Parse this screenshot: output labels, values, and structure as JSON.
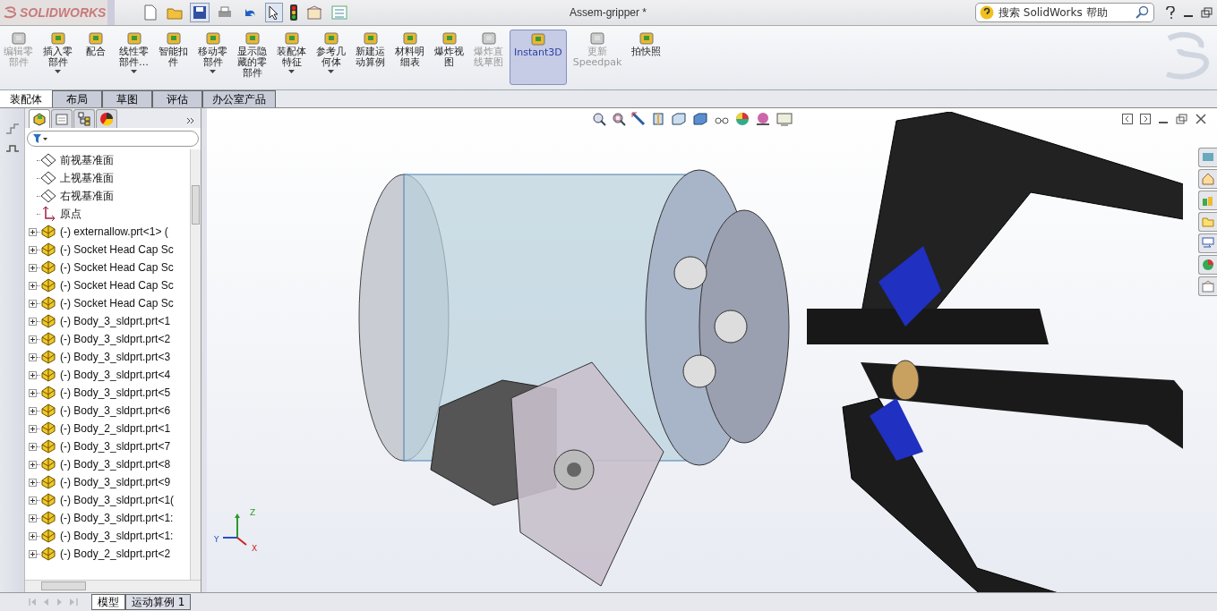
{
  "app": {
    "brand": "SOLIDWORKS"
  },
  "window": {
    "title": "Assem-gripper *"
  },
  "search": {
    "placeholder": "搜索 SolidWorks 帮助"
  },
  "ribbon": [
    {
      "lines": [
        "编辑零",
        "部件"
      ],
      "disabled": true,
      "dropdown": false,
      "selected": false
    },
    {
      "lines": [
        "插入零",
        "部件"
      ],
      "disabled": false,
      "dropdown": true,
      "selected": false
    },
    {
      "lines": [
        "配合"
      ],
      "disabled": false,
      "dropdown": false,
      "selected": false
    },
    {
      "lines": [
        "线性零",
        "部件…"
      ],
      "disabled": false,
      "dropdown": true,
      "selected": false
    },
    {
      "lines": [
        "智能扣",
        "件"
      ],
      "disabled": false,
      "dropdown": false,
      "selected": false
    },
    {
      "lines": [
        "移动零",
        "部件"
      ],
      "disabled": false,
      "dropdown": true,
      "selected": false
    },
    {
      "lines": [
        "显示隐",
        "藏的零",
        "部件"
      ],
      "disabled": false,
      "dropdown": false,
      "selected": false
    },
    {
      "lines": [
        "装配体",
        "特征"
      ],
      "disabled": false,
      "dropdown": true,
      "selected": false
    },
    {
      "lines": [
        "参考几",
        "何体"
      ],
      "disabled": false,
      "dropdown": true,
      "selected": false
    },
    {
      "lines": [
        "新建运",
        "动算例"
      ],
      "disabled": false,
      "dropdown": false,
      "selected": false
    },
    {
      "lines": [
        "材料明",
        "细表"
      ],
      "disabled": false,
      "dropdown": false,
      "selected": false
    },
    {
      "lines": [
        "爆炸视",
        "图"
      ],
      "disabled": false,
      "dropdown": false,
      "selected": false
    },
    {
      "lines": [
        "爆炸直",
        "线草图"
      ],
      "disabled": true,
      "dropdown": false,
      "selected": false
    },
    {
      "lines": [
        "Instant3D"
      ],
      "disabled": false,
      "dropdown": false,
      "selected": true
    },
    {
      "lines": [
        "更新",
        "Speedpak"
      ],
      "disabled": true,
      "dropdown": false,
      "selected": false
    },
    {
      "lines": [
        "拍快照"
      ],
      "disabled": false,
      "dropdown": false,
      "selected": false
    }
  ],
  "tabs": [
    {
      "label": "装配体",
      "selected": true
    },
    {
      "label": "布局",
      "selected": false
    },
    {
      "label": "草图",
      "selected": false
    },
    {
      "label": "评估",
      "selected": false
    },
    {
      "label": "办公室产品",
      "selected": false
    }
  ],
  "tree": [
    {
      "kind": "plane",
      "label": "前视基准面"
    },
    {
      "kind": "plane",
      "label": "上视基准面"
    },
    {
      "kind": "plane",
      "label": "右视基准面"
    },
    {
      "kind": "origin",
      "label": "原点"
    },
    {
      "kind": "component",
      "label": "(-) externallow.prt<1> ("
    },
    {
      "kind": "component",
      "label": "(-) Socket Head Cap Sc"
    },
    {
      "kind": "component",
      "label": "(-) Socket Head Cap Sc"
    },
    {
      "kind": "component",
      "label": "(-) Socket Head Cap Sc"
    },
    {
      "kind": "component",
      "label": "(-) Socket Head Cap Sc"
    },
    {
      "kind": "component",
      "label": "(-) Body_3_sldprt.prt<1"
    },
    {
      "kind": "component",
      "label": "(-) Body_3_sldprt.prt<2"
    },
    {
      "kind": "component",
      "label": "(-) Body_3_sldprt.prt<3"
    },
    {
      "kind": "component",
      "label": "(-) Body_3_sldprt.prt<4"
    },
    {
      "kind": "component",
      "label": "(-) Body_3_sldprt.prt<5"
    },
    {
      "kind": "component",
      "label": "(-) Body_3_sldprt.prt<6"
    },
    {
      "kind": "component",
      "label": "(-) Body_2_sldprt.prt<1"
    },
    {
      "kind": "component",
      "label": "(-) Body_3_sldprt.prt<7"
    },
    {
      "kind": "component",
      "label": "(-) Body_3_sldprt.prt<8"
    },
    {
      "kind": "component",
      "label": "(-) Body_3_sldprt.prt<9"
    },
    {
      "kind": "component",
      "label": "(-) Body_3_sldprt.prt<1("
    },
    {
      "kind": "component",
      "label": "(-) Body_3_sldprt.prt<1:"
    },
    {
      "kind": "component",
      "label": "(-) Body_3_sldprt.prt<1:"
    },
    {
      "kind": "component",
      "label": "(-) Body_2_sldprt.prt<2"
    }
  ],
  "triad": {
    "z": "Z",
    "y": "Y",
    "x": "X"
  },
  "bottom_tabs": [
    {
      "label": "模型",
      "selected": true
    },
    {
      "label": "运动算例 1",
      "selected": false
    }
  ]
}
